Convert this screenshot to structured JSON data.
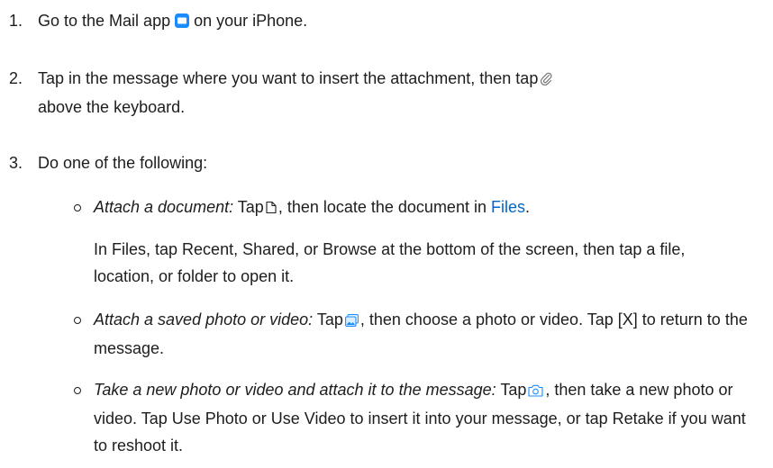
{
  "steps": [
    {
      "number": "1.",
      "text_before": "Go to the Mail app",
      "text_after": "on your iPhone.",
      "icon": "mail-app-icon"
    },
    {
      "number": "2.",
      "text_before": "Tap in the message where you want to insert the attachment, then tap",
      "text_after": "above the keyboard.",
      "icon": "paperclip-icon"
    },
    {
      "number": "3.",
      "text": "Do one of the following:"
    }
  ],
  "options": [
    {
      "label": "Attach a document:",
      "text_before": "Tap",
      "text_middle": ", then locate the document in",
      "link": "Files",
      "text_after": ".",
      "icon": "document-icon"
    },
    {
      "note": "In Files, tap Recent, Shared, or Browse at the bottom of the screen, then tap a file, location, or folder to open it."
    },
    {
      "label": "Attach a saved photo or video:",
      "text_before": "Tap",
      "text_after": ", then choose a photo or video. Tap [X] to return to the message.",
      "icon": "photo-library-icon"
    },
    {
      "label": "Take a new photo or video and attach it to the message:",
      "text_before": "Tap",
      "text_after": ", then take a new photo or video. Tap Use Photo or Use Video to insert it into your message, or tap Retake if you want to reshoot it.",
      "icon": "camera-icon"
    }
  ],
  "colors": {
    "link": "#0066cc",
    "text": "#1d1d1f",
    "mail_icon": "#1a8cff"
  }
}
